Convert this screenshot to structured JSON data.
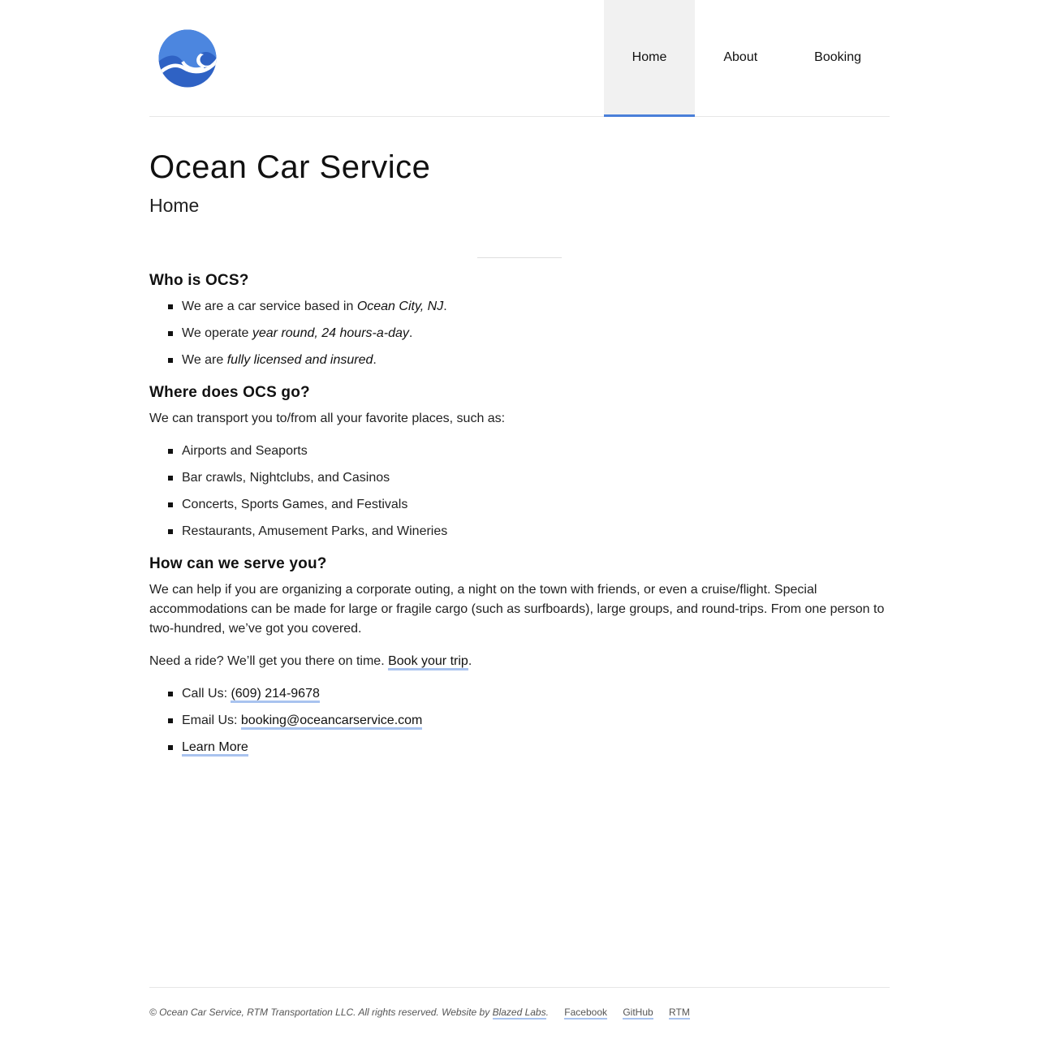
{
  "site": {
    "title": "Ocean Car Service",
    "subtitle": "Home",
    "logo_icon": "wave-logo-icon",
    "accent_color": "#4a7fd9",
    "link_underline_color": "#a9c3ef"
  },
  "nav": {
    "items": [
      {
        "label": "Home",
        "active": true
      },
      {
        "label": "About",
        "active": false
      },
      {
        "label": "Booking",
        "active": false
      }
    ]
  },
  "sections": {
    "who": {
      "heading": "Who is OCS?",
      "items": [
        {
          "pre": "We are a car service based in ",
          "em": "Ocean City, NJ",
          "post": "."
        },
        {
          "pre": "We operate ",
          "em": "year round, 24 hours-a-day",
          "post": "."
        },
        {
          "pre": "We are ",
          "em": "fully licensed and insured",
          "post": "."
        }
      ]
    },
    "where": {
      "heading": "Where does OCS go?",
      "intro": "We can transport you to/from all your favorite places, such as:",
      "items": [
        "Airports and Seaports",
        "Bar crawls, Nightclubs, and Casinos",
        "Concerts, Sports Games, and Festivals",
        "Restaurants, Amusement Parks, and Wineries"
      ]
    },
    "how": {
      "heading": "How can we serve you?",
      "paragraph": "We can help if you are organizing a corporate outing, a night on the town with friends, or even a cruise/flight. Special accommodations can be made for large or fragile cargo (such as surfboards), large groups, and round-trips. From one person to two-hundred, we’ve got you covered.",
      "cta_pre": "Need a ride? We’ll get you there on time. ",
      "cta_link": "Book your trip",
      "cta_post": ".",
      "contact": {
        "call_label": "Call Us: ",
        "phone": "(609) 214-9678",
        "email_label": "Email Us: ",
        "email": "booking@oceancarservice.com",
        "learn_more": "Learn More"
      }
    }
  },
  "footer": {
    "copyright": "© Ocean Car Service, RTM Transportation LLC. All rights reserved. Website by ",
    "credit_link": "Blazed Labs",
    "credit_post": ".",
    "links": [
      "Facebook",
      "GitHub",
      "RTM"
    ]
  }
}
